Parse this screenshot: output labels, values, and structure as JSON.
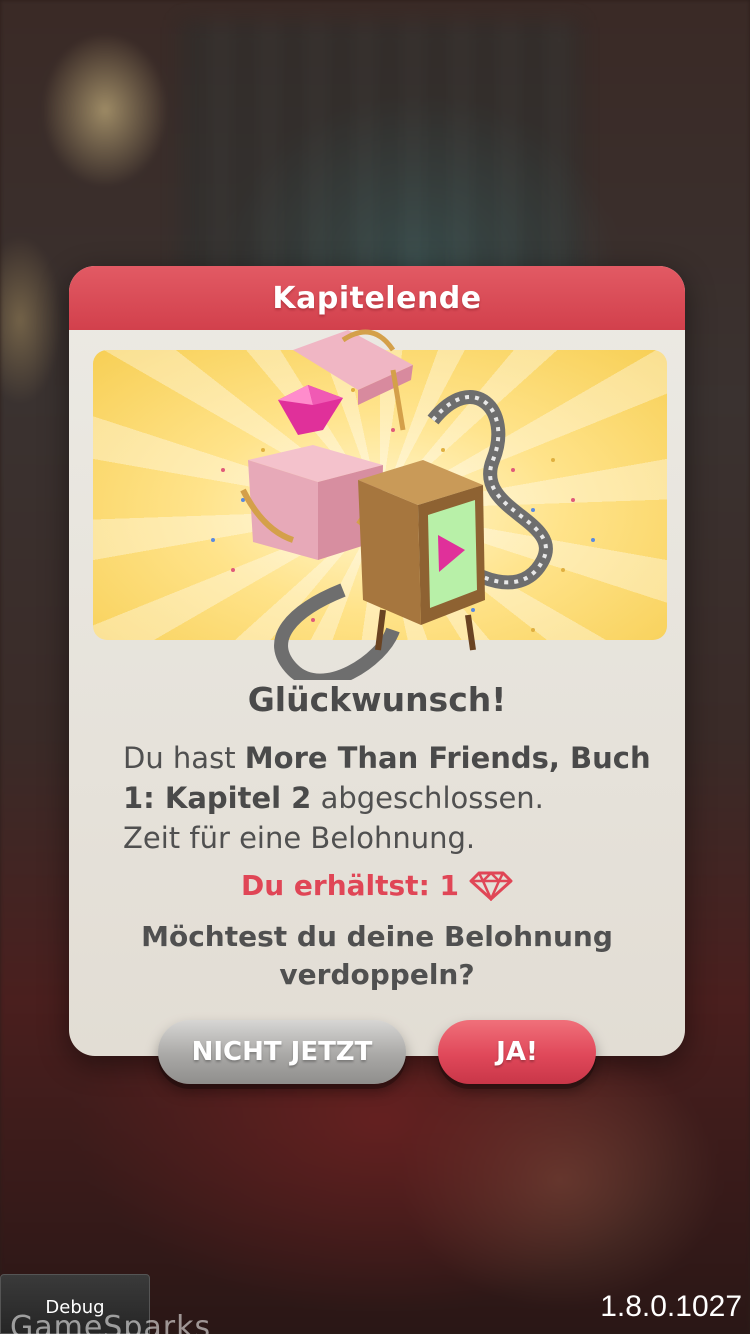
{
  "dialog": {
    "title": "Kapitelende",
    "congrats": "Glückwunsch!",
    "message": {
      "prefix": "Du hast ",
      "story_bold": "More Than Friends, Buch 1: Kapitel 2",
      "suffix": " abgeschlossen.",
      "line3": "Zeit für eine Belohnung."
    },
    "reward_text": "Du erhältst: 1",
    "reward_icon": "gem-icon",
    "question": "Möchtest du deine Belohnung verdoppeln?",
    "buttons": {
      "decline": "NICHT JETZT",
      "accept": "JA!"
    }
  },
  "footer": {
    "debug_label": "Debug",
    "sdk_label": "GameSparks",
    "version": "1.8.0.1027"
  },
  "colors": {
    "header": "#d94a56",
    "accent": "#e04656",
    "dialog_bg": "#e6e2da"
  }
}
